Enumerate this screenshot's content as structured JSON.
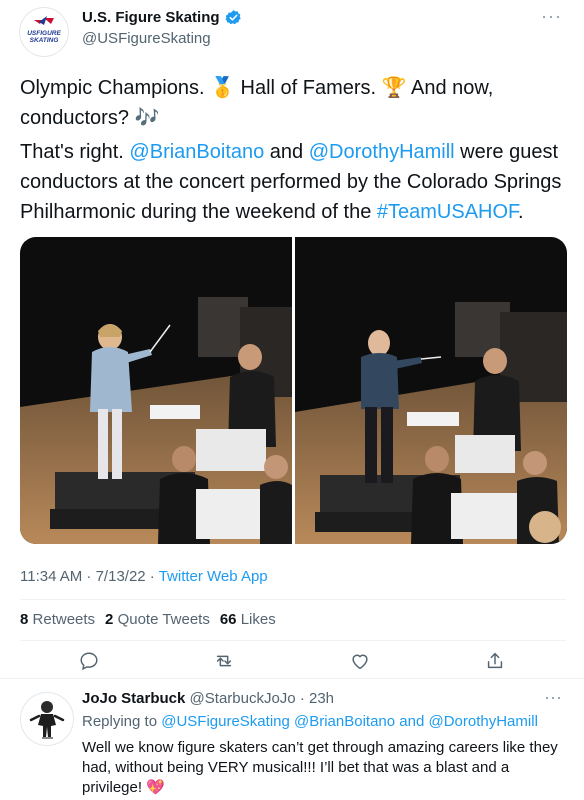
{
  "tweet": {
    "author_name": "U.S. Figure Skating",
    "author_handle": "@USFigureSkating",
    "logo_text_line1": "USFIGURE",
    "logo_text_line2": "SKATING",
    "text1_a": "Olympic Champions. ",
    "text1_emoji1": "🥇",
    "text1_b": " Hall of Famers. ",
    "text1_emoji2": "🏆",
    "text1_c": " And now, conductors? ",
    "text1_emoji3": "🎶",
    "text2_a": "That's right. ",
    "mention1": "@BrianBoitano",
    "text2_b": " and ",
    "mention2": "@DorothyHamill",
    "text2_c": " were guest conductors at the concert performed by the Colorado Springs Philharmonic during the weekend of the ",
    "hashtag": "#TeamUSAHOF",
    "text2_d": ".",
    "time": "11:34 AM · 7/13/22 · ",
    "source": "Twitter Web App",
    "retweets": "8",
    "retweets_label": "Retweets",
    "quotes": "2",
    "quotes_label": "Quote Tweets",
    "likes": "66",
    "likes_label": "Likes",
    "more": "···"
  },
  "reply": {
    "name": "JoJo Starbuck",
    "handle_time": "@StarbuckJoJo · 23h",
    "replying_label": "Replying to ",
    "replying_to": "@USFigureSkating @BrianBoitano and @DorothyHamill",
    "text": "Well we know figure skaters can’t get through amazing careers like they had, without being VERY musical!!!  I’ll bet that was a blast and a privilege! ",
    "emoji": "💖",
    "more": "···"
  },
  "icons": [
    "verified-badge-icon",
    "reply-icon",
    "retweet-icon",
    "like-icon",
    "share-icon",
    "more-icon"
  ],
  "colors": {
    "accent": "#1d9bf0",
    "muted": "#536471",
    "text": "#0f1419",
    "divider": "#eff3f4"
  }
}
